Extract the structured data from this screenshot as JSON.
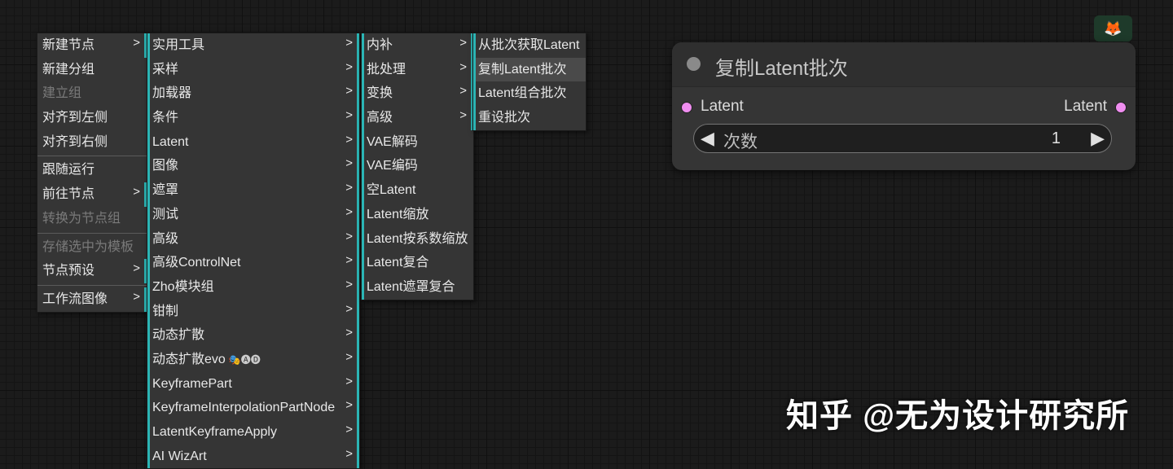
{
  "menu1": {
    "items": [
      {
        "label": "新建节点",
        "submenu": true,
        "disabled": false
      },
      {
        "label": "新建分组",
        "submenu": false,
        "disabled": false
      },
      {
        "label": "建立组",
        "submenu": false,
        "disabled": true
      },
      {
        "label": "对齐到左侧",
        "submenu": false,
        "disabled": false
      },
      {
        "label": "对齐到右侧",
        "submenu": false,
        "disabled": false
      },
      {
        "sep": true
      },
      {
        "label": "跟随运行",
        "submenu": false,
        "disabled": false
      },
      {
        "label": "前往节点",
        "submenu": true,
        "disabled": false
      },
      {
        "label": "转换为节点组",
        "submenu": false,
        "disabled": true
      },
      {
        "sep": true
      },
      {
        "label": "存储选中为模板",
        "submenu": false,
        "disabled": true
      },
      {
        "label": "节点预设",
        "submenu": true,
        "disabled": false
      },
      {
        "sep": true
      },
      {
        "label": "工作流图像",
        "submenu": true,
        "disabled": false
      }
    ]
  },
  "menu2": {
    "items": [
      {
        "label": "实用工具",
        "submenu": true
      },
      {
        "label": "采样",
        "submenu": true
      },
      {
        "label": "加载器",
        "submenu": true
      },
      {
        "label": "条件",
        "submenu": true
      },
      {
        "label": "Latent",
        "submenu": true
      },
      {
        "label": "图像",
        "submenu": true
      },
      {
        "label": "遮罩",
        "submenu": true
      },
      {
        "label": "测试",
        "submenu": true
      },
      {
        "label": "高级",
        "submenu": true
      },
      {
        "label": "高级ControlNet",
        "submenu": true
      },
      {
        "label": "Zho模块组",
        "submenu": true
      },
      {
        "label": "钳制",
        "submenu": true
      },
      {
        "label": "动态扩散",
        "submenu": true
      },
      {
        "label": "动态扩散evo",
        "submenu": true,
        "suffix": "🎭🅐🅓"
      },
      {
        "label": "KeyframePart",
        "submenu": true
      },
      {
        "label": "KeyframeInterpolationPartNode",
        "submenu": true
      },
      {
        "label": "LatentKeyframeApply",
        "submenu": true
      },
      {
        "label": "AI WizArt",
        "submenu": true
      }
    ]
  },
  "menu3": {
    "items": [
      {
        "label": "内补",
        "submenu": true
      },
      {
        "label": "批处理",
        "submenu": true
      },
      {
        "label": "变换",
        "submenu": true
      },
      {
        "label": "高级",
        "submenu": true
      },
      {
        "label": "VAE解码",
        "submenu": false
      },
      {
        "label": "VAE编码",
        "submenu": false
      },
      {
        "label": "空Latent",
        "submenu": false
      },
      {
        "label": "Latent缩放",
        "submenu": false
      },
      {
        "label": "Latent按系数缩放",
        "submenu": false
      },
      {
        "label": "Latent复合",
        "submenu": false
      },
      {
        "label": "Latent遮罩复合",
        "submenu": false
      }
    ]
  },
  "menu4": {
    "items": [
      {
        "label": "从批次获取Latent",
        "highlight": false
      },
      {
        "label": "复制Latent批次",
        "highlight": true
      },
      {
        "label": "Latent组合批次",
        "highlight": false
      },
      {
        "label": "重设批次",
        "highlight": false
      }
    ]
  },
  "node": {
    "title": "复制Latent批次",
    "input_label": "Latent",
    "output_label": "Latent",
    "widget_label": "次数",
    "widget_value": "1",
    "left_arrow": "◀",
    "right_arrow": "▶"
  },
  "corner_badge": "🦊",
  "watermark": "知乎 @无为设计研究所",
  "colors": {
    "accent": "#2bb5b5",
    "slot": "#f08ef0",
    "menu_bg": "#353535"
  }
}
